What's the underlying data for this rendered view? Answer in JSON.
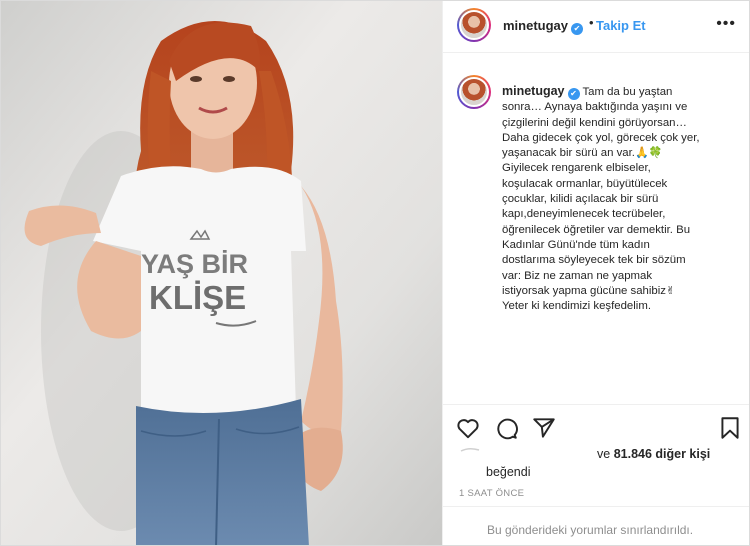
{
  "header": {
    "username": "minetugay",
    "verified_mark": "✔",
    "separator": "•",
    "follow_label": "Takip Et",
    "more_label": "•••"
  },
  "photo": {
    "shirt_text_line1": "YAŞ BİR",
    "shirt_text_line2": "KLİŞE"
  },
  "caption": {
    "username": "minetugay",
    "lines": [
      "Tam da bu yaştan",
      "sonra… Aynaya baktığında yaşını ve",
      "çizgilerini değil kendini görüyorsan…",
      "Daha gidecek çok yol, görecek çok yer,",
      "yaşanacak bir sürü an var.",
      "Giyilecek rengarenk elbiseler,",
      "koşulacak ormanlar, büyütülecek",
      "çocuklar, kilidi açılacak bir sürü",
      "kapı,deneyimlenecek tecrübeler,",
      "öğrenilecek öğretiler var demektir. Bu",
      "Kadınlar Günü'nde tüm kadın",
      "dostlarıma söyleyecek tek bir sözüm",
      "var: Biz ne zaman ne yapmak",
      "istiyorsak yapma gücüne sahibiz",
      "Yeter ki kendimizi keşfedelim."
    ],
    "emoji_pray": "🙏",
    "emoji_leaf": "🍀",
    "emoji_hand": "✌"
  },
  "actions": {
    "like_icon": "heart-icon",
    "comment_icon": "comment-icon",
    "share_icon": "send-icon",
    "save_icon": "bookmark-icon"
  },
  "likes": {
    "and_text": "ve",
    "others_text": "81.846 diğer kişi",
    "liked_text": "beğendi"
  },
  "timestamp": "1 SAAT ÖNCE",
  "comments_notice": "Bu gönderideki yorumlar sınırlandırıldı.",
  "colors": {
    "accent": "#3897f0",
    "text": "#262626",
    "muted": "#8e8e8e",
    "border": "#efefef"
  }
}
